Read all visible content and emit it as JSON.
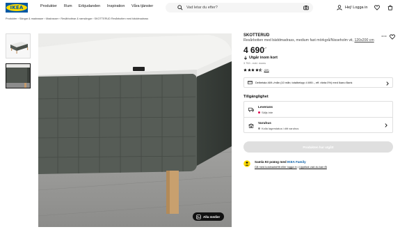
{
  "header": {
    "logo_text": "IKEA",
    "nav": [
      "Produkter",
      "Rum",
      "Erbjudanden",
      "Inspiration",
      "Våra tjänster"
    ],
    "search_placeholder": "Vad letar du efter?",
    "login_label": "Hej! Logga in",
    "icons": [
      "search-icon",
      "camera-icon",
      "user-icon",
      "heart-icon",
      "cart-icon"
    ]
  },
  "breadcrumb": "Produkter  ›  Sängar & madrasser  ›  Madrasser  ›  Resårbottnar & ramsängar  ›  SKOTTERUD Resårbotten med bäddmadrass",
  "gallery": {
    "all_media_label": "Alla medier"
  },
  "product": {
    "name": "SKOTTERUD",
    "description": "Resårbotten med bäddmadrass, medium fast mörkgrå/Nisseholm vit, ",
    "size": "120x200 cm",
    "price": "4 690",
    "price_suffix": ".-",
    "stock_label": "Utgår inom kort",
    "price_note": "3 752:- exkl. moms",
    "rating_value": 4.5,
    "rating_count": "(22)"
  },
  "finance": {
    "text": "Delbetala 469:-/mån (10 mån; totalbelopp 4 690:-, eff. ränta 0%) med Ikano Bank"
  },
  "availability": {
    "title": "Tillgänglighet",
    "delivery_title": "Leverans",
    "delivery_status": "Säljs inte",
    "store_title": "Varuhus",
    "store_status": "Kolla lagerstatus i ditt varuhus"
  },
  "buy": {
    "label": "Produkten har utgått"
  },
  "family": {
    "text_prefix": "Samla 93 poäng med ",
    "brand": "IKEA Family",
    "link1": "Gå med kostnadsfritt eller logga in",
    "separator": " | ",
    "link2": "Upptäck vad du kan få"
  },
  "colors": {
    "ikea_blue": "#0058a3",
    "ikea_yellow": "#ffdb00",
    "status_red": "#e00751",
    "status_gray": "#929292",
    "disabled_button": "#dfdfdf"
  }
}
